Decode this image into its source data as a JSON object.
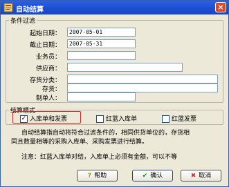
{
  "window": {
    "title": "自动结算",
    "close_glyph": "×"
  },
  "criteria": {
    "legend": "条件过滤",
    "fields": [
      {
        "label": "起始日期：",
        "value": "2007-05-01"
      },
      {
        "label": "截止日期：",
        "value": "2007-05-31"
      },
      {
        "label": "业务员：",
        "value": ""
      },
      {
        "label": "供应商：",
        "value": ""
      },
      {
        "label": "存货分类：",
        "value": ""
      },
      {
        "label": "存货：",
        "value": ""
      },
      {
        "label": "制单人：",
        "value": ""
      }
    ]
  },
  "mode": {
    "legend": "结算模式",
    "options": [
      {
        "label": "入库单和发票",
        "checked": true
      },
      {
        "label": "红蓝入库单",
        "checked": false
      },
      {
        "label": "红蓝发票",
        "checked": false
      }
    ]
  },
  "description": {
    "line1": "自动结算指自动将符合过滤条件的，相同供货单位的，存货相",
    "line2": "同且数量相等的采购入库单、采购发票进行结算。",
    "note": "注意：红蓝入库单对结，入库单上必须有金额，可以不等"
  },
  "buttons": {
    "help": "帮助",
    "ok": "确认",
    "cancel": "取消"
  },
  "colors": {
    "highlight": "#e02020",
    "title_bar": "#1c4fd2"
  }
}
